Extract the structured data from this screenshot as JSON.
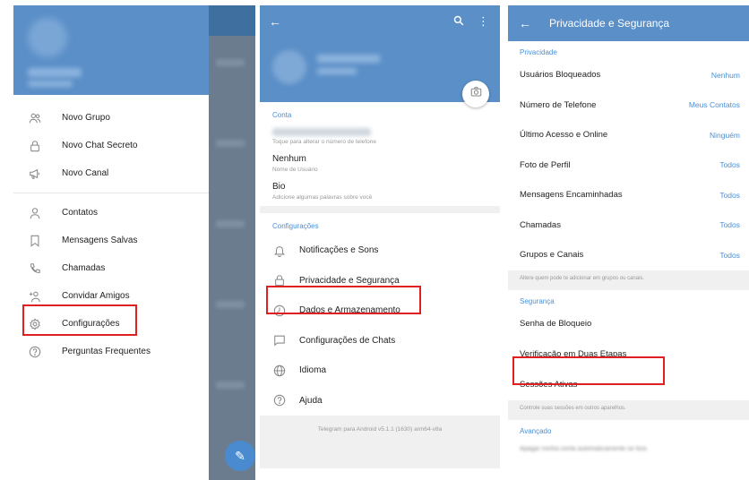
{
  "drawer": {
    "items": [
      {
        "label": "Novo Grupo",
        "icon": "group-icon"
      },
      {
        "label": "Novo Chat Secreto",
        "icon": "lock-icon"
      },
      {
        "label": "Novo Canal",
        "icon": "megaphone-icon"
      },
      {
        "label": "Contatos",
        "icon": "person-icon"
      },
      {
        "label": "Mensagens Salvas",
        "icon": "bookmark-icon"
      },
      {
        "label": "Chamadas",
        "icon": "phone-icon"
      },
      {
        "label": "Convidar Amigos",
        "icon": "add-person-icon"
      },
      {
        "label": "Configurações",
        "icon": "gear-icon"
      },
      {
        "label": "Perguntas Frequentes",
        "icon": "question-icon"
      }
    ]
  },
  "settings": {
    "account_section": "Conta",
    "phone_hint": "Toque para alterar o número de telefone",
    "username_value": "Nenhum",
    "username_hint": "Nome de Usuário",
    "bio_label": "Bio",
    "bio_hint": "Adicione algumas palavras sobre você",
    "config_section": "Configurações",
    "items": [
      {
        "label": "Notificações e Sons",
        "icon": "bell-icon"
      },
      {
        "label": "Privacidade e Segurança",
        "icon": "lock-icon"
      },
      {
        "label": "Dados e Armazenamento",
        "icon": "clock-icon"
      },
      {
        "label": "Configurações de Chats",
        "icon": "chat-icon"
      },
      {
        "label": "Idioma",
        "icon": "globe-icon"
      },
      {
        "label": "Ajuda",
        "icon": "question-icon"
      }
    ],
    "footer": "Telegram para Android v5.1.1 (1630) arm64-v8a"
  },
  "privacy": {
    "title": "Privacidade e Segurança",
    "privacy_section": "Privacidade",
    "rows": [
      {
        "label": "Usuários Bloqueados",
        "value": "Nenhum"
      },
      {
        "label": "Número de Telefone",
        "value": "Meus Contatos"
      },
      {
        "label": "Último Acesso e Online",
        "value": "Ninguém"
      },
      {
        "label": "Foto de Perfil",
        "value": "Todos"
      },
      {
        "label": "Mensagens Encaminhadas",
        "value": "Todos"
      },
      {
        "label": "Chamadas",
        "value": "Todos"
      },
      {
        "label": "Grupos e Canais",
        "value": "Todos"
      }
    ],
    "groups_hint": "Altere quem pode te adicionar em grupos ou canais.",
    "security_section": "Segurança",
    "security_rows": [
      "Senha de Bloqueio",
      "Verificação em Duas Etapas",
      "Sessões Ativas"
    ],
    "sessions_hint": "Controle suas sessões em outros aparelhos.",
    "advanced_section": "Avançado",
    "advanced_hint": "Apagar minha conta automaticamente se fora"
  }
}
